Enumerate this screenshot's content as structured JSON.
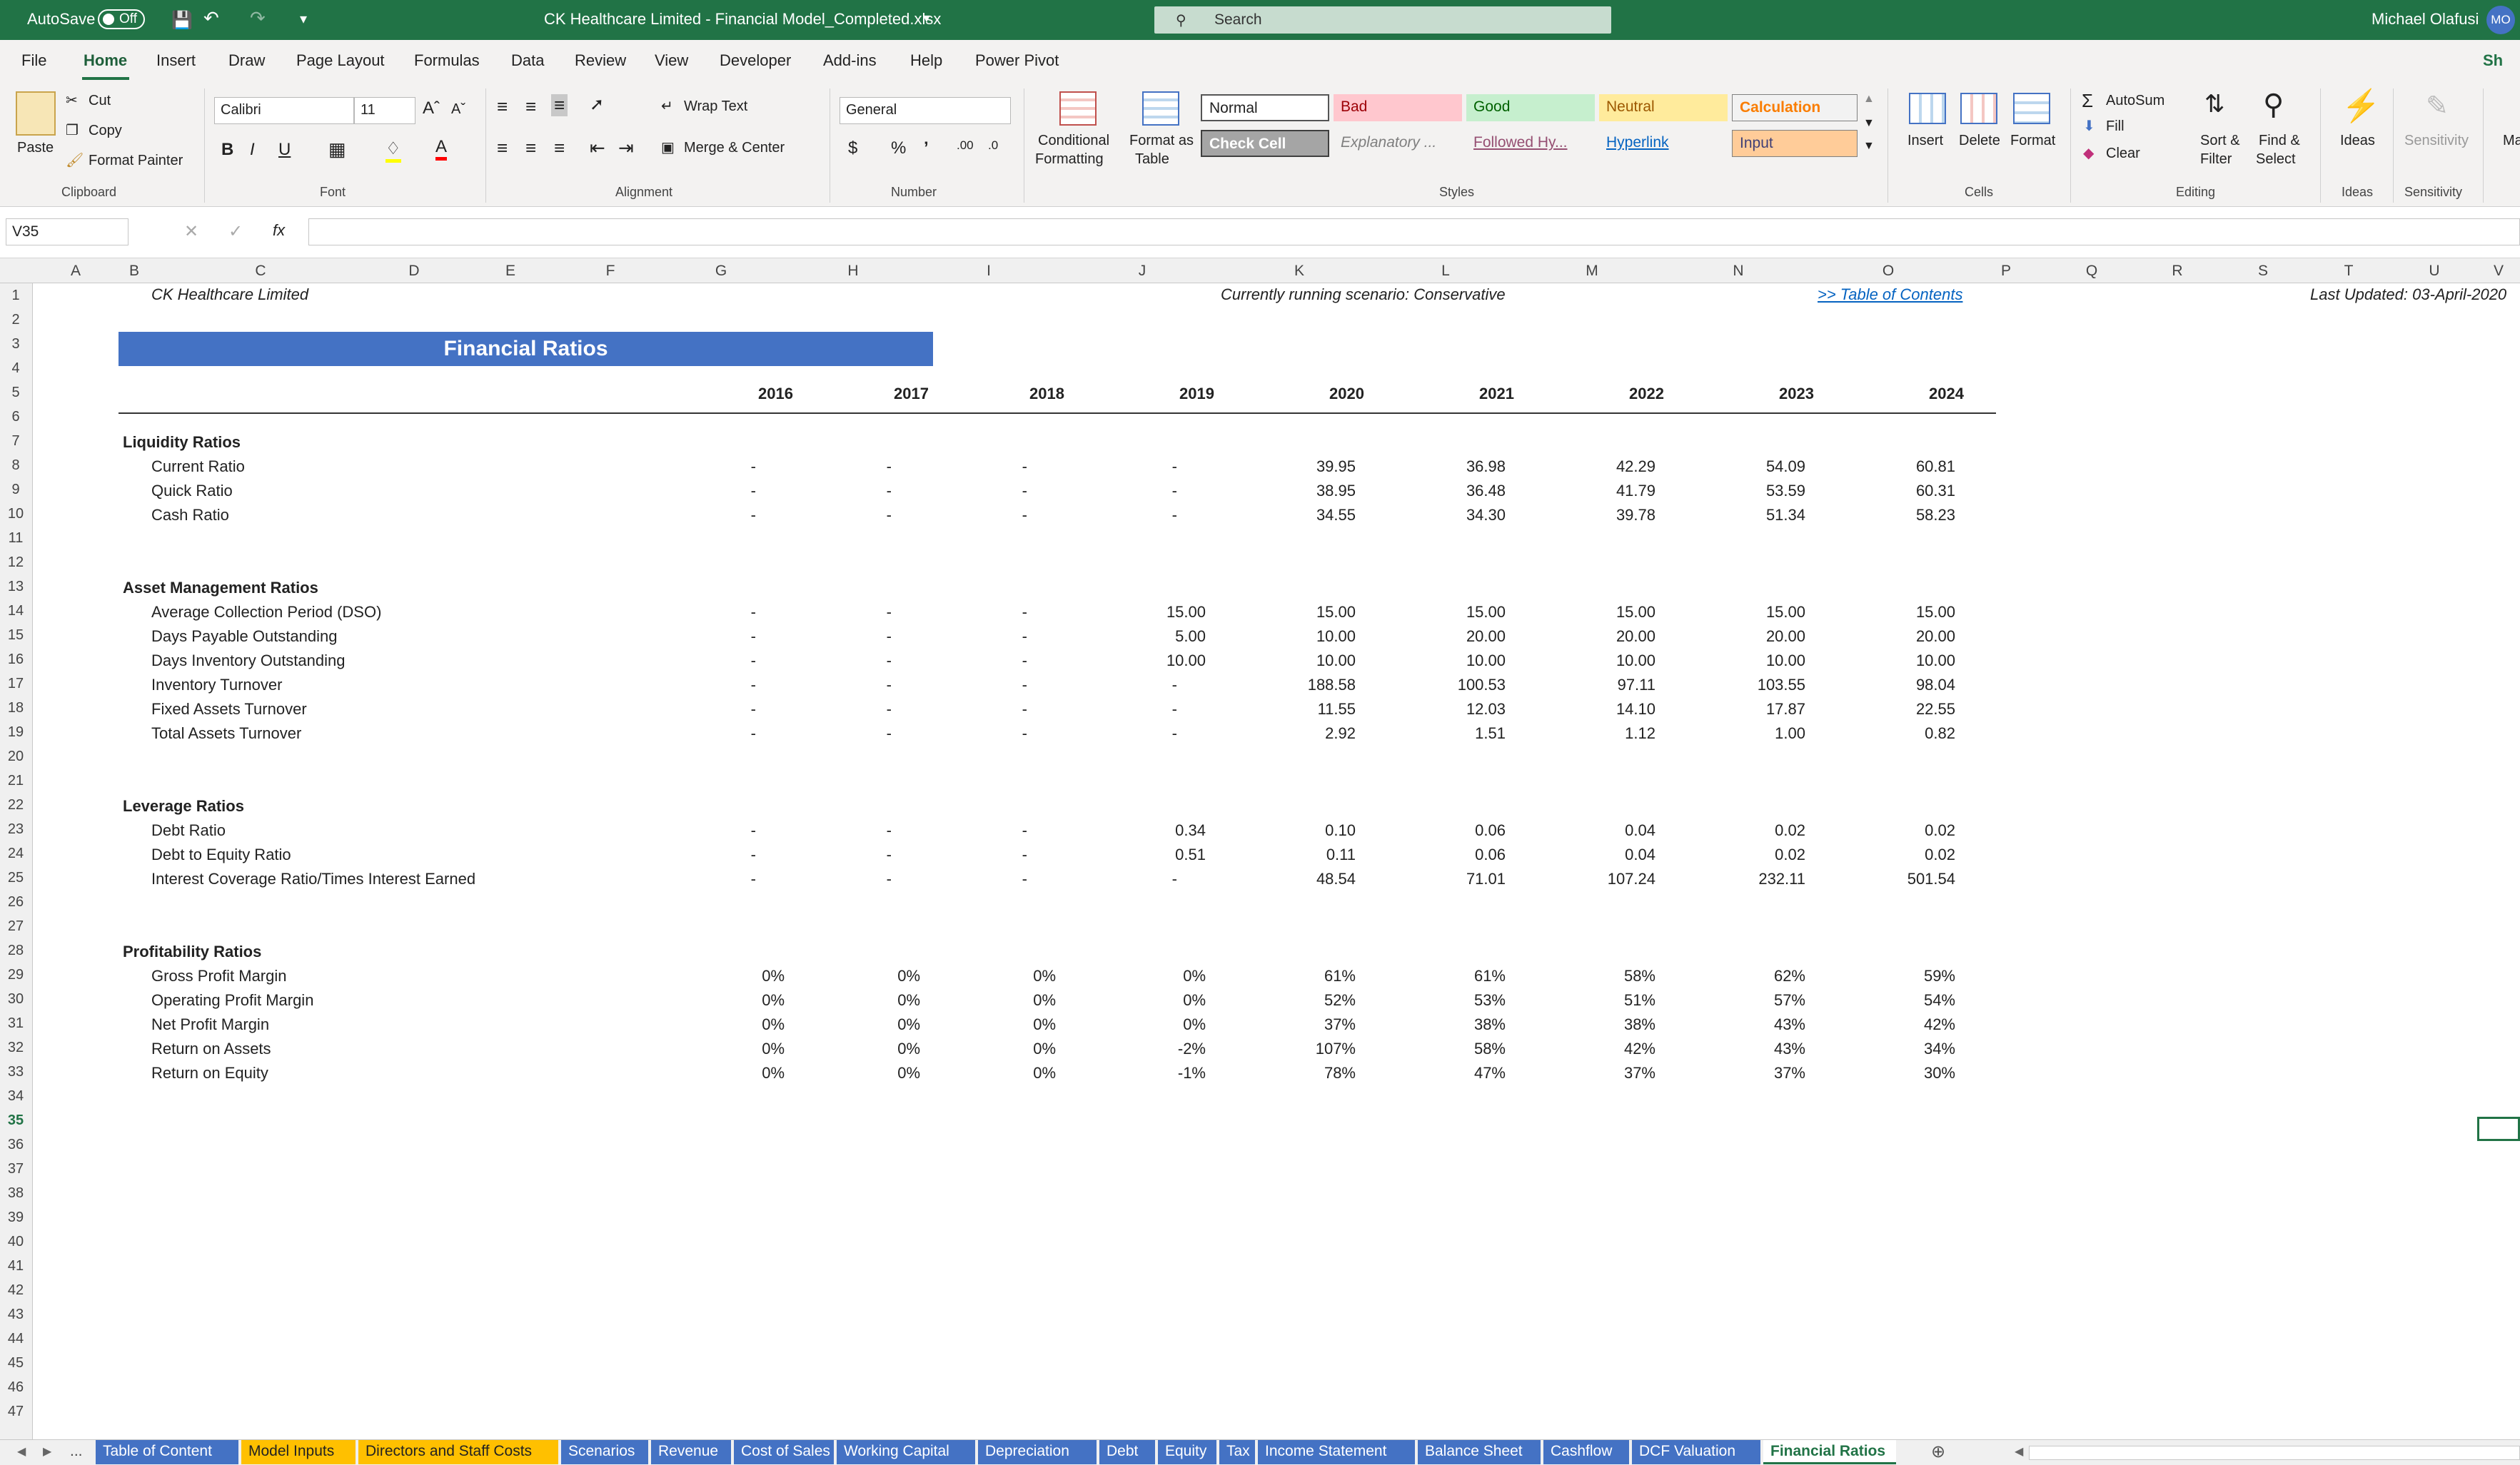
{
  "titlebar": {
    "autosave_label": "AutoSave",
    "autosave_state": "Off",
    "file_title": "CK Healthcare Limited - Financial Model_Completed.xlsx",
    "search_placeholder": "Search",
    "user_name": "Michael Olafusi",
    "user_initials": "MO"
  },
  "menu": [
    "File",
    "Home",
    "Insert",
    "Draw",
    "Page Layout",
    "Formulas",
    "Data",
    "Review",
    "View",
    "Developer",
    "Add-ins",
    "Help",
    "Power Pivot"
  ],
  "share_label": "Sh",
  "ribbon": {
    "clipboard": {
      "paste": "Paste",
      "cut": "Cut",
      "copy": "Copy",
      "format_painter": "Format Painter",
      "group": "Clipboard"
    },
    "font": {
      "name": "Calibri",
      "size": "11",
      "group": "Font"
    },
    "alignment": {
      "wrap": "Wrap Text",
      "merge": "Merge & Center",
      "group": "Alignment"
    },
    "number": {
      "format": "General",
      "group": "Number"
    },
    "styles": {
      "cond": "Conditional",
      "cond2": "Formatting",
      "fmt_table": "Format as",
      "fmt_table2": "Table",
      "normal": "Normal",
      "bad": "Bad",
      "good": "Good",
      "neutral": "Neutral",
      "calculation": "Calculation",
      "check": "Check Cell",
      "explanatory": "Explanatory ...",
      "followed": "Followed Hy...",
      "hyperlink": "Hyperlink",
      "input": "Input",
      "group": "Styles"
    },
    "cells": {
      "insert": "Insert",
      "delete": "Delete",
      "format": "Format",
      "group": "Cells"
    },
    "editing": {
      "autosum": "AutoSum",
      "fill": "Fill",
      "clear": "Clear",
      "sort": "Sort &",
      "sort2": "Filter",
      "find": "Find &",
      "find2": "Select",
      "group": "Editing"
    },
    "ideas": {
      "label": "Ideas",
      "group": "Ideas"
    },
    "sensitivity": {
      "label": "Sensitivity",
      "group": "Sensitivity"
    },
    "extra": "Ma"
  },
  "formula": {
    "namebox": "V35",
    "fx": "fx"
  },
  "columns": [
    "A",
    "B",
    "C",
    "D",
    "E",
    "F",
    "G",
    "H",
    "I",
    "J",
    "K",
    "L",
    "M",
    "N",
    "O",
    "P",
    "Q",
    "R",
    "S",
    "T",
    "U",
    "V"
  ],
  "sheet": {
    "company": "CK Healthcare Limited",
    "scenario": "Currently running scenario: Conservative",
    "toc_link": ">> Table of Contents",
    "updated": "Last Updated: 03-April-2020",
    "banner": "Financial Ratios",
    "years": [
      "2016",
      "2017",
      "2018",
      "2019",
      "2020",
      "2021",
      "2022",
      "2023",
      "2024"
    ],
    "sections": [
      {
        "title": "Liquidity Ratios",
        "row": 7,
        "items": [
          {
            "label": "Current Ratio",
            "row": 8,
            "values": [
              "-",
              "-",
              "-",
              "-",
              "39.95",
              "36.98",
              "42.29",
              "54.09",
              "60.81"
            ]
          },
          {
            "label": "Quick Ratio",
            "row": 9,
            "values": [
              "-",
              "-",
              "-",
              "-",
              "38.95",
              "36.48",
              "41.79",
              "53.59",
              "60.31"
            ]
          },
          {
            "label": "Cash Ratio",
            "row": 10,
            "values": [
              "-",
              "-",
              "-",
              "-",
              "34.55",
              "34.30",
              "39.78",
              "51.34",
              "58.23"
            ]
          }
        ]
      },
      {
        "title": "Asset Management Ratios",
        "row": 13,
        "items": [
          {
            "label": "Average Collection Period (DSO)",
            "row": 14,
            "values": [
              "-",
              "-",
              "-",
              "15.00",
              "15.00",
              "15.00",
              "15.00",
              "15.00",
              "15.00"
            ]
          },
          {
            "label": "Days Payable Outstanding",
            "row": 15,
            "values": [
              "-",
              "-",
              "-",
              "5.00",
              "10.00",
              "20.00",
              "20.00",
              "20.00",
              "20.00"
            ]
          },
          {
            "label": "Days Inventory Outstanding",
            "row": 16,
            "values": [
              "-",
              "-",
              "-",
              "10.00",
              "10.00",
              "10.00",
              "10.00",
              "10.00",
              "10.00"
            ]
          },
          {
            "label": "Inventory Turnover",
            "row": 17,
            "values": [
              "-",
              "-",
              "-",
              "-",
              "188.58",
              "100.53",
              "97.11",
              "103.55",
              "98.04"
            ]
          },
          {
            "label": "Fixed Assets Turnover",
            "row": 18,
            "values": [
              "-",
              "-",
              "-",
              "-",
              "11.55",
              "12.03",
              "14.10",
              "17.87",
              "22.55"
            ]
          },
          {
            "label": "Total Assets Turnover",
            "row": 19,
            "values": [
              "-",
              "-",
              "-",
              "-",
              "2.92",
              "1.51",
              "1.12",
              "1.00",
              "0.82"
            ]
          }
        ]
      },
      {
        "title": "Leverage Ratios",
        "row": 22,
        "items": [
          {
            "label": "Debt Ratio",
            "row": 23,
            "values": [
              "-",
              "-",
              "-",
              "0.34",
              "0.10",
              "0.06",
              "0.04",
              "0.02",
              "0.02"
            ]
          },
          {
            "label": "Debt to Equity Ratio",
            "row": 24,
            "values": [
              "-",
              "-",
              "-",
              "0.51",
              "0.11",
              "0.06",
              "0.04",
              "0.02",
              "0.02"
            ]
          },
          {
            "label": "Interest Coverage Ratio/Times Interest Earned",
            "row": 25,
            "values": [
              "-",
              "-",
              "-",
              "-",
              "48.54",
              "71.01",
              "107.24",
              "232.11",
              "501.54"
            ]
          }
        ]
      },
      {
        "title": "Profitability Ratios",
        "row": 28,
        "items": [
          {
            "label": "Gross Profit Margin",
            "row": 29,
            "values": [
              "0%",
              "0%",
              "0%",
              "0%",
              "61%",
              "61%",
              "58%",
              "62%",
              "59%"
            ]
          },
          {
            "label": "Operating Profit Margin",
            "row": 30,
            "values": [
              "0%",
              "0%",
              "0%",
              "0%",
              "52%",
              "53%",
              "51%",
              "57%",
              "54%"
            ]
          },
          {
            "label": "Net Profit Margin",
            "row": 31,
            "values": [
              "0%",
              "0%",
              "0%",
              "0%",
              "37%",
              "38%",
              "38%",
              "43%",
              "42%"
            ]
          },
          {
            "label": "Return on Assets",
            "row": 32,
            "values": [
              "0%",
              "0%",
              "0%",
              "-2%",
              "107%",
              "58%",
              "42%",
              "43%",
              "34%"
            ]
          },
          {
            "label": "Return on Equity",
            "row": 33,
            "values": [
              "0%",
              "0%",
              "0%",
              "-1%",
              "78%",
              "47%",
              "37%",
              "37%",
              "30%"
            ]
          }
        ]
      }
    ]
  },
  "tabs": [
    {
      "label": "Table of Content",
      "color": "#4472c4"
    },
    {
      "label": "Model Inputs",
      "color": "#ffc000"
    },
    {
      "label": "Directors and Staff Costs",
      "color": "#ffc000"
    },
    {
      "label": "Scenarios",
      "color": "#4472c4"
    },
    {
      "label": "Revenue",
      "color": "#4472c4"
    },
    {
      "label": "Cost of Sales",
      "color": "#4472c4"
    },
    {
      "label": "Working Capital",
      "color": "#4472c4"
    },
    {
      "label": "Depreciation",
      "color": "#4472c4"
    },
    {
      "label": "Debt",
      "color": "#4472c4"
    },
    {
      "label": "Equity",
      "color": "#4472c4"
    },
    {
      "label": "Tax",
      "color": "#4472c4"
    },
    {
      "label": "Income Statement",
      "color": "#4472c4"
    },
    {
      "label": "Balance Sheet",
      "color": "#4472c4"
    },
    {
      "label": "Cashflow",
      "color": "#4472c4"
    },
    {
      "label": "DCF Valuation",
      "color": "#4472c4"
    },
    {
      "label": "Financial Ratios",
      "color": "#ffffff",
      "active": true
    }
  ],
  "tab_more": "..."
}
